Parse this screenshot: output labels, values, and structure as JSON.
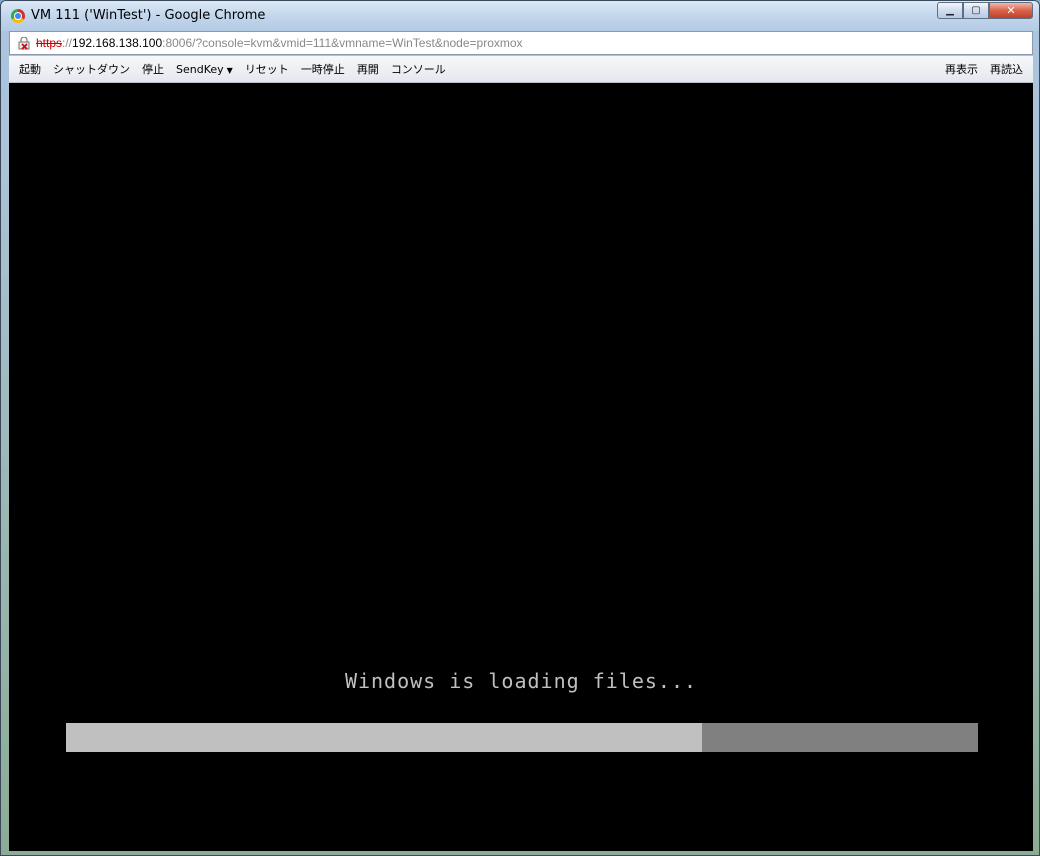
{
  "window": {
    "title": "VM 111 ('WinTest') - Google Chrome",
    "controls": {
      "minimize_icon": "minimize-icon",
      "maximize_icon": "maximize-icon",
      "close_icon": "close-icon"
    }
  },
  "address": {
    "scheme": "https",
    "separator": "://",
    "host": "192.168.138.100",
    "rest": ":8006/?console=kvm&vmid=111&vmname=WinTest&node=proxmox",
    "security_icon": "insecure-lock-icon"
  },
  "toolbar": {
    "left": [
      {
        "label": "起動"
      },
      {
        "label": "シャットダウン"
      },
      {
        "label": "停止"
      },
      {
        "label": "SendKey",
        "dropdown": true
      },
      {
        "label": "リセット"
      },
      {
        "label": "一時停止"
      },
      {
        "label": "再開"
      },
      {
        "label": "コンソール"
      }
    ],
    "right": [
      {
        "label": "再表示"
      },
      {
        "label": "再読込"
      }
    ]
  },
  "console": {
    "message": "Windows is loading files...",
    "progress": 0.697,
    "colors": {
      "background": "#000000",
      "text": "#c0c0c0",
      "bar_fill": "#c0c0c0",
      "bar_track": "#808080"
    }
  }
}
